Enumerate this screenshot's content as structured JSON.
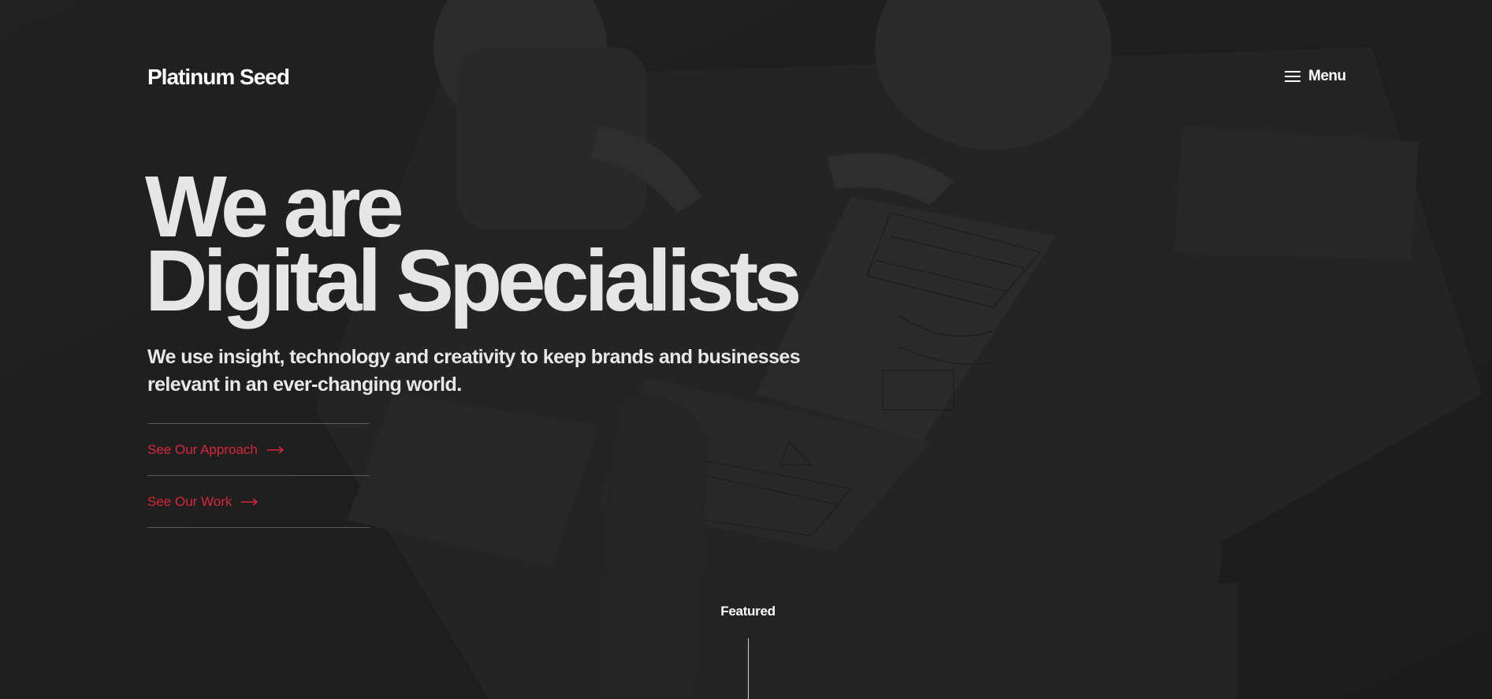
{
  "header": {
    "logo": "Platinum Seed",
    "menu_label": "Menu"
  },
  "hero": {
    "headline_line1": "We are",
    "headline_line2": "Digital Specialists",
    "subline": "We use insight, technology and creativity to keep brands and businesses relevant in an ever-changing world.",
    "links": [
      {
        "label": "See Our Approach"
      },
      {
        "label": "See Our Work"
      }
    ],
    "featured_label": "Featured"
  },
  "colors": {
    "background": "#1f1f1f",
    "accent_red": "#d7263d",
    "text": "#ffffff"
  },
  "icons": {
    "menu": "hamburger-icon",
    "link_arrow": "arrow-right-icon"
  }
}
